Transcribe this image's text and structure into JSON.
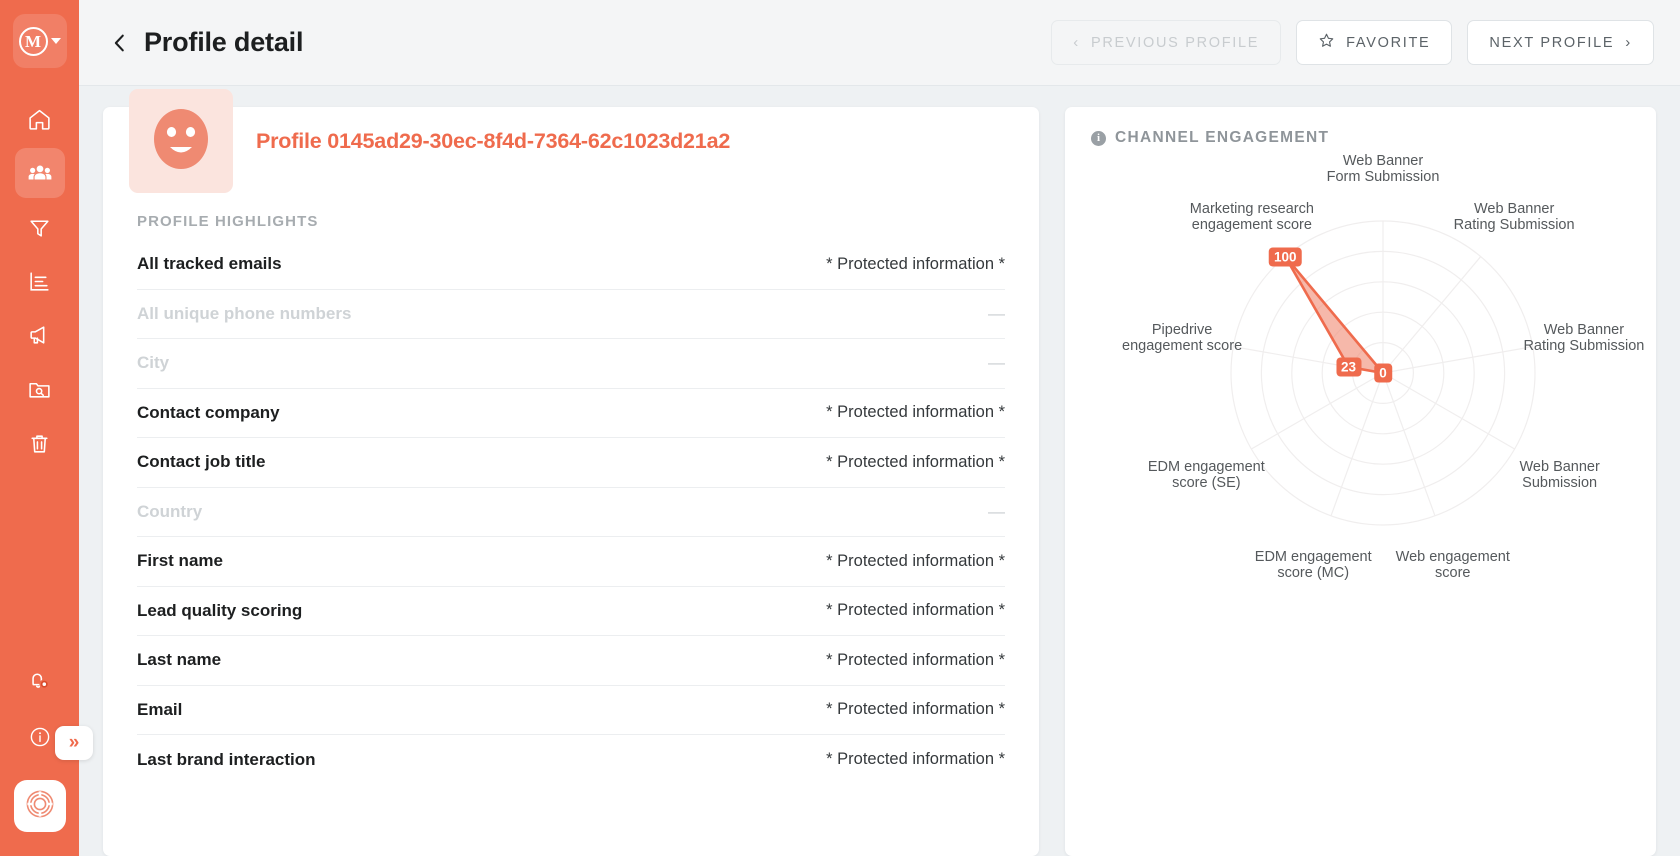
{
  "sidebar": {
    "brand": {
      "letter": "M",
      "name": "brand-logo"
    },
    "items": [
      {
        "icon": "home-icon",
        "name": "sidebar-item-home",
        "active": false
      },
      {
        "icon": "people-icon",
        "name": "sidebar-item-profiles",
        "active": true
      },
      {
        "icon": "funnel-icon",
        "name": "sidebar-item-segments",
        "active": false
      },
      {
        "icon": "bar-chart-icon",
        "name": "sidebar-item-reports",
        "active": false
      },
      {
        "icon": "megaphone-icon",
        "name": "sidebar-item-campaigns",
        "active": false
      },
      {
        "icon": "folder-search-icon",
        "name": "sidebar-item-library",
        "active": false
      },
      {
        "icon": "trash-icon",
        "name": "sidebar-item-trash",
        "active": false
      }
    ],
    "bottom_items": [
      {
        "icon": "bell-alert-icon",
        "name": "sidebar-item-notifications"
      },
      {
        "icon": "info-circle-icon",
        "name": "sidebar-item-help"
      }
    ],
    "expand_label": "»",
    "account_icon": "account-avatar-icon"
  },
  "header": {
    "back_icon": "back-chevron-icon",
    "title": "Profile detail",
    "buttons": {
      "previous": {
        "label": "PREVIOUS PROFILE",
        "icon": "chevron-left-icon",
        "disabled": true
      },
      "favorite": {
        "label": "FAVORITE",
        "icon": "star-icon",
        "disabled": false
      },
      "next": {
        "label": "NEXT PROFILE",
        "icon": "chevron-right-icon",
        "disabled": false
      }
    }
  },
  "profile": {
    "avatar_icon": "smiley-face-avatar",
    "id_text": "Profile 0145ad29-30ec-8f4d-7364-62c1023d21a2",
    "highlights_label": "PROFILE HIGHLIGHTS",
    "protected_value": "* Protected information *",
    "empty_value": "—",
    "rows": [
      {
        "label": "All tracked emails",
        "value": "* Protected information *",
        "empty": false
      },
      {
        "label": "All unique phone numbers",
        "value": "—",
        "empty": true
      },
      {
        "label": "City",
        "value": "—",
        "empty": true
      },
      {
        "label": "Contact company",
        "value": "* Protected information *",
        "empty": false
      },
      {
        "label": "Contact job title",
        "value": "* Protected information *",
        "empty": false
      },
      {
        "label": "Country",
        "value": "—",
        "empty": true
      },
      {
        "label": "First name",
        "value": "* Protected information *",
        "empty": false
      },
      {
        "label": "Lead quality scoring",
        "value": "* Protected information *",
        "empty": false
      },
      {
        "label": "Last name",
        "value": "* Protected information *",
        "empty": false
      },
      {
        "label": "Email",
        "value": "* Protected information *",
        "empty": false
      },
      {
        "label": "Last brand interaction",
        "value": "* Protected information *",
        "empty": false
      }
    ]
  },
  "panel": {
    "info_icon": "info-circle-icon",
    "title": "CHANNEL ENGAGEMENT"
  },
  "colors": {
    "accent": "#ef6b4d",
    "accent_fill": "#f08d76",
    "sidebar": "#ef6b4d",
    "page_bg": "#eef1f3",
    "topbar_bg": "#f4f5f6",
    "card_bg": "#ffffff",
    "grid": "#f0eeee",
    "label_text": "#55595c"
  },
  "chart_data": {
    "type": "radar",
    "title": "CHANNEL ENGAGEMENT",
    "rmax": 100,
    "rings": 5,
    "grid": true,
    "legend": "none",
    "categories": [
      "Web Banner\nForm Submission",
      "Web Banner\nRating Submission",
      "Web Banner\nRating Submission",
      "Web Banner\nSubmission",
      "Web engagement score",
      "EDM engagement\nscore (MC)",
      "EDM engagement\nscore (SE)",
      "Pipedrive\nengagement score",
      "Marketing research\nengagement score"
    ],
    "series": [
      {
        "name": "Channel engagement",
        "values": [
          0,
          0,
          0,
          0,
          0,
          0,
          0,
          23,
          100
        ]
      }
    ],
    "labeled_points": [
      {
        "category": "Marketing research\nengagement score",
        "value": 100
      },
      {
        "category": "Pipedrive\nengagement score",
        "value": 23
      },
      {
        "category": "Web Banner\nForm Submission",
        "value": 0
      }
    ]
  }
}
